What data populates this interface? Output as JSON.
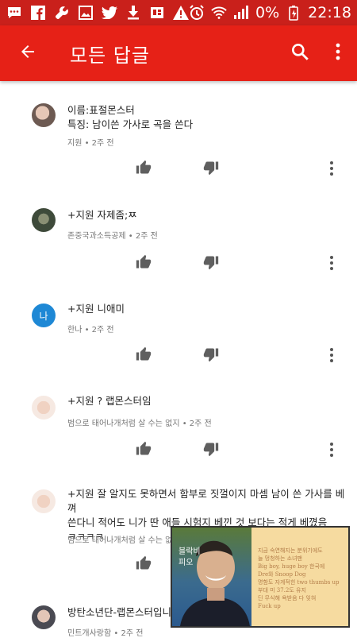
{
  "status_bar": {
    "battery": "0%",
    "time": "22:18",
    "icons": [
      "chat-icon",
      "facebook-icon",
      "wrench-icon",
      "image-icon",
      "twitter-icon",
      "download-icon",
      "app-icon",
      "warning-icon",
      "alarm-icon",
      "wifi-icon",
      "signal-icon",
      "battery-icon"
    ]
  },
  "app_bar": {
    "title": "모든 답글",
    "background": "#e62117"
  },
  "comments": [
    {
      "lines": [
        "이름:표절몬스터",
        "특징: 남이쓴 가사로 곡을 쓴다"
      ],
      "meta": "지원 • 2주 전"
    },
    {
      "lines": [
        "+지원 자제좀;ㅉ"
      ],
      "meta": "존중국과소득공제 • 2주 전"
    },
    {
      "lines": [
        "+지원 니애미"
      ],
      "meta": "한나 • 2주 전",
      "avatar_letter": "나"
    },
    {
      "lines": [
        "+지원 ? 랩몬스터임"
      ],
      "meta": "범으로 태어나개처럼 살 수는 없지 • 2주 전"
    },
    {
      "lines": [
        "+지원 잘 알지도 못하면서 함부로 짓껄이지 마셈 남이 쓴 가사를 베껴",
        "쓴다니 적어도 니가 딴 애들 시험지 베낀 것 보다는 적게 베꼈음",
        "ㅋㅋㅋㅋ"
      ],
      "meta": "범으로 태어나개처럼 살 수는 없"
    },
    {
      "lines": [
        "방탄소년단-랩몬스터입니"
      ],
      "meta": "민트개사랑함 • 2주 전"
    }
  ],
  "video_overlay": {
    "tag": "블락비\n피오",
    "lyrics": [
      "지금 숙연해지는 분위기에도",
      "늘 멍청하는 소녀팬",
      "Big boy, huge boy 한국에",
      "Dre와 Snoop Dog",
      "명함도 자게적힌 two thumbs up",
      "부대 미 37.2도 유지",
      "딘 무식해 욕받음 다 잊혀",
      "Fuck up"
    ]
  }
}
